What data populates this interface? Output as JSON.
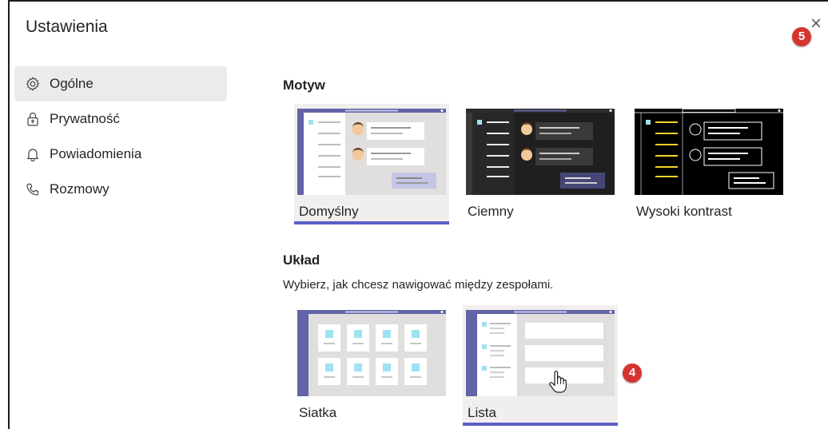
{
  "window": {
    "title": "Ustawienia",
    "close_glyph": "×",
    "badges": {
      "close_step": "5",
      "layout_step": "4"
    }
  },
  "sidebar": {
    "items": [
      {
        "label": "Ogólne",
        "icon": "gear-icon",
        "active": true
      },
      {
        "label": "Prywatność",
        "icon": "lock-icon",
        "active": false
      },
      {
        "label": "Powiadomienia",
        "icon": "bell-icon",
        "active": false
      },
      {
        "label": "Rozmowy",
        "icon": "phone-icon",
        "active": false
      }
    ]
  },
  "theme": {
    "title": "Motyw",
    "options": [
      {
        "label": "Domyślny",
        "selected": true
      },
      {
        "label": "Ciemny",
        "selected": false
      },
      {
        "label": "Wysoki kontrast",
        "selected": false
      }
    ]
  },
  "layout": {
    "title": "Układ",
    "description": "Wybierz, jak chcesz nawigować między zespołami.",
    "options": [
      {
        "label": "Siatka",
        "selected": false
      },
      {
        "label": "Lista",
        "selected": true
      }
    ]
  },
  "colors": {
    "accent": "#5b5fc7",
    "rail": "#6264a7",
    "badge": "#d6352f",
    "selected_bg": "#f0efee",
    "dark_bg": "#1f1f1f",
    "hc_bg": "#000000",
    "hc_yellow": "#f5d22e"
  }
}
